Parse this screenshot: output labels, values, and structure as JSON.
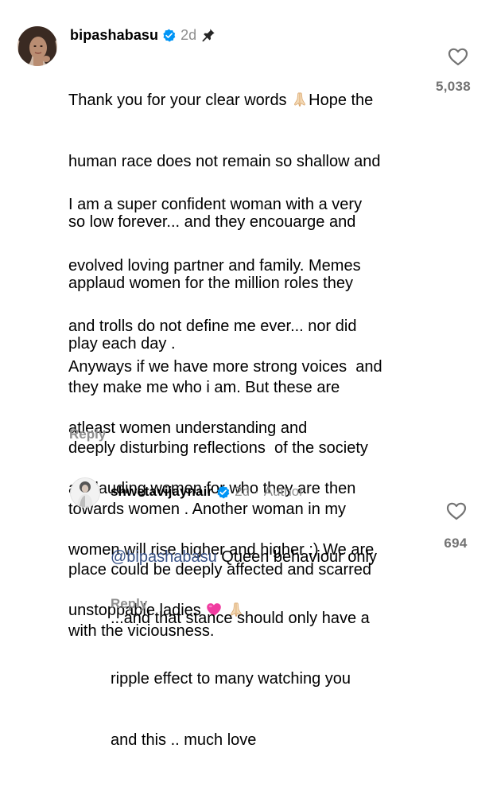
{
  "comments": [
    {
      "username": "bipashabasu",
      "time": "2d",
      "verified": true,
      "pinned": true,
      "paragraphs": [
        {
          "lines": [
            [
              "Thank you for your clear words ",
              {
                "emoji": "folded-hands"
              },
              "Hope the"
            ],
            [
              "human race does not remain so shallow and"
            ],
            [
              "so low forever... and they encouarge and"
            ],
            [
              "applaud women for the million roles they"
            ],
            [
              "play each day ."
            ]
          ]
        },
        {
          "lines": [
            [
              "I am a super confident woman with a very"
            ],
            [
              "evolved loving partner and family. Memes"
            ],
            [
              "and trolls do not define me ever... nor did"
            ],
            [
              "they make me who i am. But these are"
            ],
            [
              "deeply disturbing reflections  of the society"
            ],
            [
              "towards women . Another woman in my"
            ],
            [
              "place could be deeply affected and scarred"
            ],
            [
              "with the viciousness."
            ]
          ]
        },
        {
          "lines": [
            [
              "Anyways if we have more strong voices  and"
            ],
            [
              "atleast women understanding and"
            ],
            [
              "applauding women for who they are then"
            ],
            [
              "women will rise higher and higher :) We are"
            ],
            [
              "unstoppable ladies ",
              {
                "emoji": "pink-heart"
              },
              " ",
              {
                "emoji": "folded-hands"
              }
            ]
          ]
        }
      ],
      "reply_label": "Reply",
      "like_count": "5,038"
    },
    {
      "username": "shwetavijaynair",
      "time": "2d",
      "verified": true,
      "author_label": "Author",
      "separator": "·",
      "paragraphs": [
        {
          "lines": [
            [
              {
                "mention": "@bipashabasu"
              },
              " Queen behaviour only"
            ],
            [
              "...and that stance should only have a"
            ],
            [
              "ripple effect to many watching you"
            ],
            [
              "and this .. much love"
            ]
          ]
        }
      ],
      "reply_label": "Reply",
      "like_count": "694"
    }
  ],
  "colors": {
    "verified": "#0095f6",
    "secondary_text": "#8e8e8e",
    "mention": "#385185",
    "count": "#737373"
  },
  "icons": [
    "verified-badge-icon",
    "pin-icon",
    "heart-outline-icon",
    "folded-hands-emoji",
    "pink-heart-emoji"
  ]
}
